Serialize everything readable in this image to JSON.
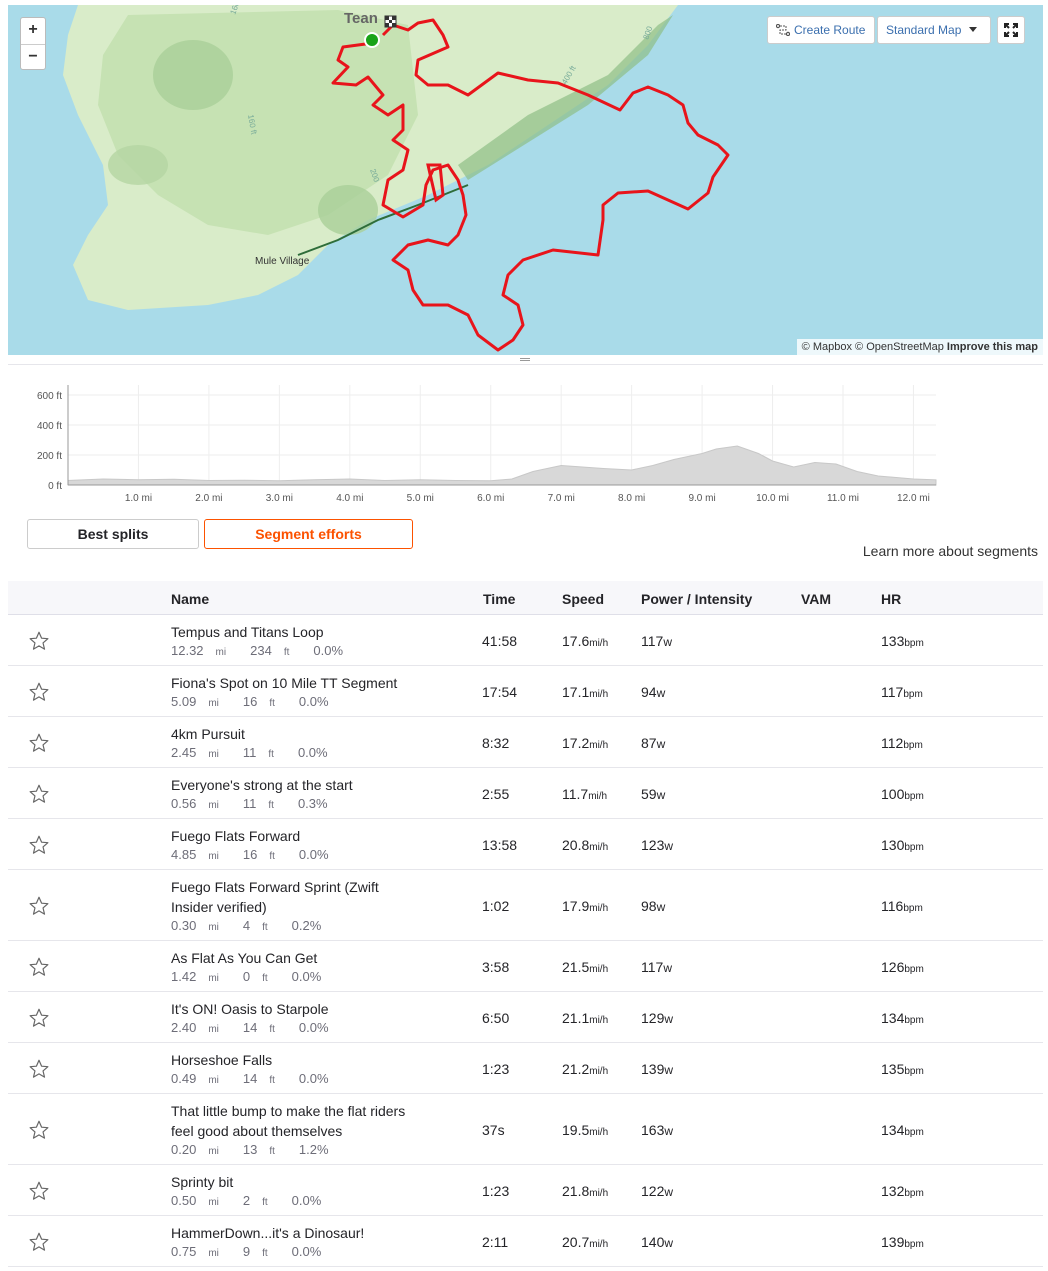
{
  "map": {
    "place_label_top": "Tean",
    "place_label_village": "Mule Village",
    "contour_labels": [
      "160 ft",
      "200",
      "400 ft",
      "800",
      "160 ft"
    ],
    "create_route_label": "Create Route",
    "map_type_label": "Standard Map",
    "attribution_mapbox": "© Mapbox",
    "attribution_osm": "© OpenStreetMap",
    "attribution_improve": "Improve this map",
    "colors": {
      "route": "#e8141b",
      "water": "#a9dbe9",
      "land": "#cfe7c0",
      "start": "#19a319"
    }
  },
  "chart_data": {
    "type": "area",
    "title": "",
    "xlabel": "",
    "ylabel": "",
    "x_ticks": [
      "1.0 mi",
      "2.0 mi",
      "3.0 mi",
      "4.0 mi",
      "5.0 mi",
      "6.0 mi",
      "7.0 mi",
      "8.0 mi",
      "9.0 mi",
      "10.0 mi",
      "11.0 mi",
      "12.0 mi"
    ],
    "y_ticks": [
      "0 ft",
      "200 ft",
      "400 ft",
      "600 ft"
    ],
    "xlim": [
      0,
      12.32
    ],
    "ylim": [
      0,
      600
    ],
    "grid": true,
    "x": [
      0,
      0.5,
      1.0,
      1.5,
      2.0,
      2.5,
      3.0,
      3.5,
      4.0,
      4.5,
      5.0,
      5.5,
      6.0,
      6.3,
      6.6,
      7.0,
      7.3,
      7.6,
      8.0,
      8.3,
      8.6,
      9.0,
      9.2,
      9.5,
      9.8,
      10.0,
      10.3,
      10.6,
      10.9,
      11.2,
      11.5,
      12.0,
      12.32
    ],
    "y": [
      30,
      40,
      35,
      38,
      30,
      32,
      28,
      35,
      40,
      30,
      35,
      30,
      28,
      40,
      90,
      130,
      120,
      110,
      100,
      130,
      170,
      210,
      240,
      260,
      210,
      160,
      120,
      150,
      140,
      90,
      60,
      40,
      35
    ],
    "color": "#d8d8d8"
  },
  "tabs": {
    "best_splits": "Best splits",
    "segment_efforts": "Segment efforts"
  },
  "learn_more": "Learn more about segments",
  "table": {
    "headers": {
      "name": "Name",
      "time": "Time",
      "speed": "Speed",
      "power": "Power / Intensity",
      "vam": "VAM",
      "hr": "HR"
    },
    "units": {
      "dist": "mi",
      "elev": "ft",
      "speed": "mi/h",
      "power": "w",
      "hr": "bpm"
    },
    "rows": [
      {
        "name": "Tempus and Titans Loop",
        "dist": "12.32",
        "elev": "234",
        "grade": "0.0%",
        "time": "41:58",
        "speed": "17.6",
        "power": "117",
        "hr": "133"
      },
      {
        "name": "Fiona's Spot on 10 Mile TT Segment",
        "dist": "5.09",
        "elev": "16",
        "grade": "0.0%",
        "time": "17:54",
        "speed": "17.1",
        "power": "94",
        "hr": "117"
      },
      {
        "name": "4km Pursuit",
        "dist": "2.45",
        "elev": "11",
        "grade": "0.0%",
        "time": "8:32",
        "speed": "17.2",
        "power": "87",
        "hr": "112"
      },
      {
        "name": "Everyone's strong at the start",
        "dist": "0.56",
        "elev": "11",
        "grade": "0.3%",
        "time": "2:55",
        "speed": "11.7",
        "power": "59",
        "hr": "100"
      },
      {
        "name": "Fuego Flats Forward",
        "dist": "4.85",
        "elev": "16",
        "grade": "0.0%",
        "time": "13:58",
        "speed": "20.8",
        "power": "123",
        "hr": "130"
      },
      {
        "name": "Fuego Flats Forward Sprint (Zwift Insider verified)",
        "dist": "0.30",
        "elev": "4",
        "grade": "0.2%",
        "time": "1:02",
        "speed": "17.9",
        "power": "98",
        "hr": "116"
      },
      {
        "name": "As Flat As You Can Get",
        "dist": "1.42",
        "elev": "0",
        "grade": "0.0%",
        "time": "3:58",
        "speed": "21.5",
        "power": "117",
        "hr": "126"
      },
      {
        "name": "It's ON! Oasis to Starpole",
        "dist": "2.40",
        "elev": "14",
        "grade": "0.0%",
        "time": "6:50",
        "speed": "21.1",
        "power": "129",
        "hr": "134"
      },
      {
        "name": "Horseshoe Falls",
        "dist": "0.49",
        "elev": "14",
        "grade": "0.0%",
        "time": "1:23",
        "speed": "21.2",
        "power": "139",
        "hr": "135"
      },
      {
        "name": "That little bump to make the flat riders feel good about themselves",
        "dist": "0.20",
        "elev": "13",
        "grade": "1.2%",
        "time": "37s",
        "speed": "19.5",
        "power": "163",
        "hr": "134"
      },
      {
        "name": "Sprinty bit",
        "dist": "0.50",
        "elev": "2",
        "grade": "0.0%",
        "time": "1:23",
        "speed": "21.8",
        "power": "122",
        "hr": "132"
      },
      {
        "name": "HammerDown...it's a Dinosaur!",
        "dist": "0.75",
        "elev": "9",
        "grade": "0.0%",
        "time": "2:11",
        "speed": "20.7",
        "power": "140",
        "hr": "139"
      }
    ]
  }
}
